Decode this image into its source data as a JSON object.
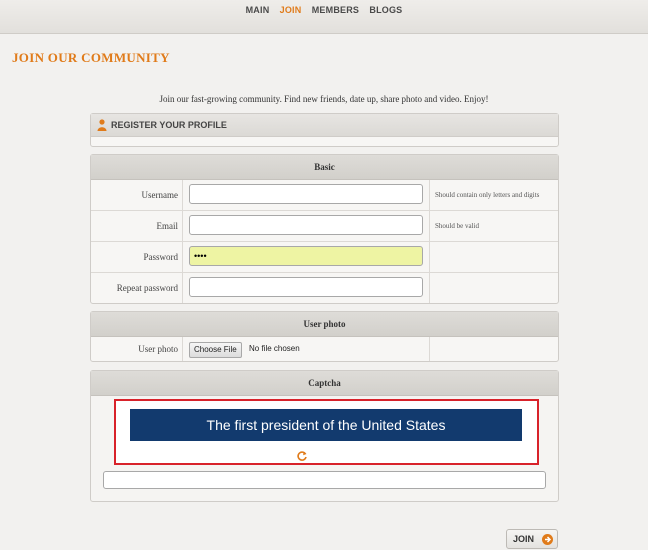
{
  "nav": {
    "items": [
      {
        "label": "MAIN"
      },
      {
        "label": "JOIN"
      },
      {
        "label": "MEMBERS"
      },
      {
        "label": "BLOGS"
      }
    ],
    "active": "JOIN"
  },
  "page": {
    "title": "JOIN OUR COMMUNITY",
    "intro": "Join our fast-growing community. Find new friends, date up, share photo and video. Enjoy!"
  },
  "register": {
    "heading": "REGISTER YOUR PROFILE",
    "icon": "user-icon"
  },
  "basic": {
    "heading": "Basic",
    "username_label": "Username",
    "username_value": "",
    "username_hint": "Should contain only letters and digits",
    "email_label": "Email",
    "email_value": "",
    "email_hint": "Should be valid",
    "password_label": "Password",
    "password_value": "••••",
    "repeat_label": "Repeat password",
    "repeat_value": ""
  },
  "photo": {
    "heading": "User photo",
    "label": "User photo",
    "button": "Choose File",
    "status": "No file chosen"
  },
  "captcha": {
    "heading": "Captcha",
    "text": "The first president of the United States",
    "input_value": ""
  },
  "actions": {
    "join": "JOIN"
  },
  "colors": {
    "accent": "#e07b1a",
    "captcha_bg": "#123a6e",
    "highlight_border": "#d8222a",
    "filled_field": "#eef4a3"
  }
}
